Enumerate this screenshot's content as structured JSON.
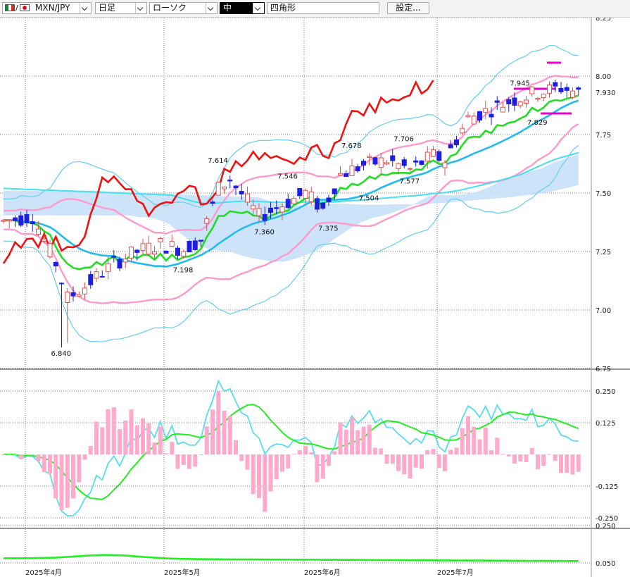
{
  "toolbar": {
    "symbol": "MXN/JPY",
    "period": "日足",
    "chart_type": "ローソク",
    "style": "中",
    "marker": "四角形",
    "settings_label": "設定..."
  },
  "colors": {
    "up_candle": "#e05050",
    "down_candle": "#1e1ee0",
    "cloud_up": "#c8e0f8",
    "cloud_down": "#f8c8dc",
    "ma_short": "#22dd22",
    "ma_mid": "#22bbee",
    "ma_long": "#44e0f0",
    "lagging": "#ee1111",
    "bb1": "#ff99cc",
    "bb2": "#66ccf0",
    "macd": "#55ddf0",
    "signal": "#22ee22",
    "hist": "#ffaacc",
    "adx": "#22ee22",
    "marker": "#ee00cc"
  },
  "chart_data": {
    "type": "candlestick",
    "panels": {
      "price": {
        "y_ticks": [
          "8.25",
          "8.00",
          "7.75",
          "7.50",
          "7.25",
          "7.00",
          "6.75"
        ],
        "ylim": [
          6.75,
          8.25
        ],
        "last_price_label": "7.930",
        "annotations": [
          {
            "text": "6.840",
            "value": 6.84
          },
          {
            "text": "7.198",
            "value": 7.198
          },
          {
            "text": "7.614",
            "value": 7.614
          },
          {
            "text": "7.360",
            "value": 7.36
          },
          {
            "text": "7.546",
            "value": 7.546
          },
          {
            "text": "7.375",
            "value": 7.375
          },
          {
            "text": "7.678",
            "value": 7.678
          },
          {
            "text": "7.504",
            "value": 7.504
          },
          {
            "text": "7.706",
            "value": 7.706
          },
          {
            "text": "7.577",
            "value": 7.577
          },
          {
            "text": "7.945",
            "value": 7.945
          },
          {
            "text": "7.829",
            "value": 7.829
          }
        ]
      },
      "macd": {
        "y_ticks": [
          "0.250",
          "0.125",
          "-0.125",
          "-0.250"
        ],
        "ylim": [
          -0.25,
          0.25
        ]
      },
      "adx": {
        "y_ticks": [
          "0.250",
          "0.050"
        ],
        "ylim": [
          0.05,
          0.25
        ]
      }
    },
    "x_labels": [
      "2025年4月",
      "2025年5月",
      "2025年6月",
      "2025年7月"
    ]
  }
}
